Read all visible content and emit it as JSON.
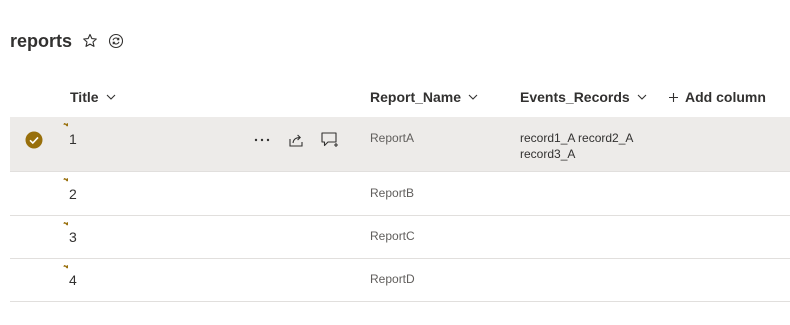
{
  "list": {
    "title": "reports"
  },
  "columns": {
    "title": "Title",
    "report_name": "Report_Name",
    "events_records": "Events_Records",
    "add_column": "Add column"
  },
  "rows": [
    {
      "title": "1",
      "report_name": "ReportA",
      "events_records": "record1_A record2_A record3_A",
      "selected": true
    },
    {
      "title": "2",
      "report_name": "ReportB",
      "events_records": "",
      "selected": false
    },
    {
      "title": "3",
      "report_name": "ReportC",
      "events_records": "",
      "selected": false
    },
    {
      "title": "4",
      "report_name": "ReportD",
      "events_records": "",
      "selected": false
    }
  ],
  "colors": {
    "accent": "#986f0b",
    "selected_row_bg": "#edebe9",
    "divider": "#e1dfdd"
  },
  "icons": [
    "star-icon",
    "sync-icon",
    "chevron-down-icon",
    "plus-icon",
    "checkmark-circle-icon",
    "new-item-icon",
    "more-icon",
    "share-icon",
    "comment-icon"
  ]
}
